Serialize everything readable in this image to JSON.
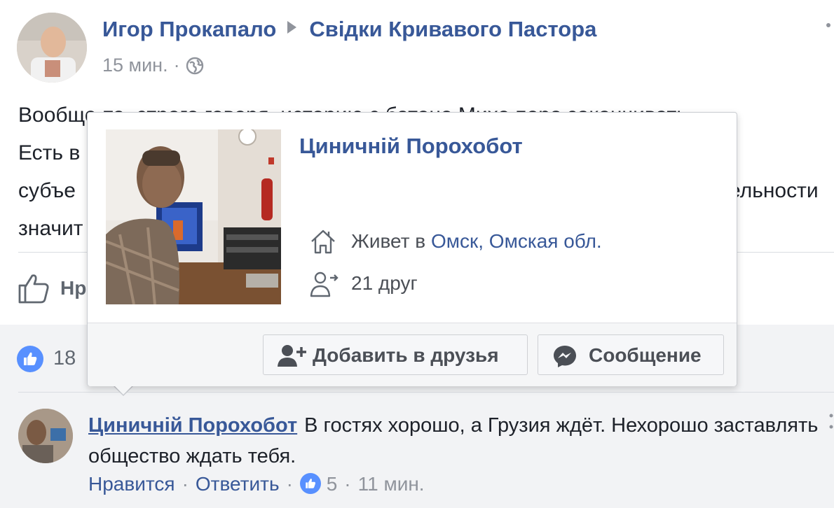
{
  "post": {
    "author": "Игор Прокапало",
    "group": "Свідки Кривавого Пастора",
    "time": "15 мин.",
    "separator": "·",
    "text_lines": [
      "Вообще-то, строго говоря, историю с батоно Михо пора заканчивать.",
      "Есть в",
      "субъе",
      "значит"
    ],
    "text_right_fragments": [
      "ельности"
    ],
    "like_label": "Нр"
  },
  "reactions": {
    "count": "18"
  },
  "hovercard": {
    "name": "Циничній Порохобот",
    "lives_prefix": "Живет в ",
    "location": "Омск, Омская обл.",
    "friends": "21 друг",
    "add_friend_label": "Добавить в друзья",
    "message_label": "Сообщение"
  },
  "comment": {
    "author": "Циничній Порохобот",
    "text": "В гостях хорошо, а Грузия ждёт. Нехорошо заставлять общество ждать тебя.",
    "like_action": "Нравится",
    "reply_action": "Ответить",
    "separator": "·",
    "reaction_count": "5",
    "time": "11 мин."
  },
  "colors": {
    "link": "#385898",
    "like_blue": "#5890ff",
    "muted": "#90949c"
  }
}
